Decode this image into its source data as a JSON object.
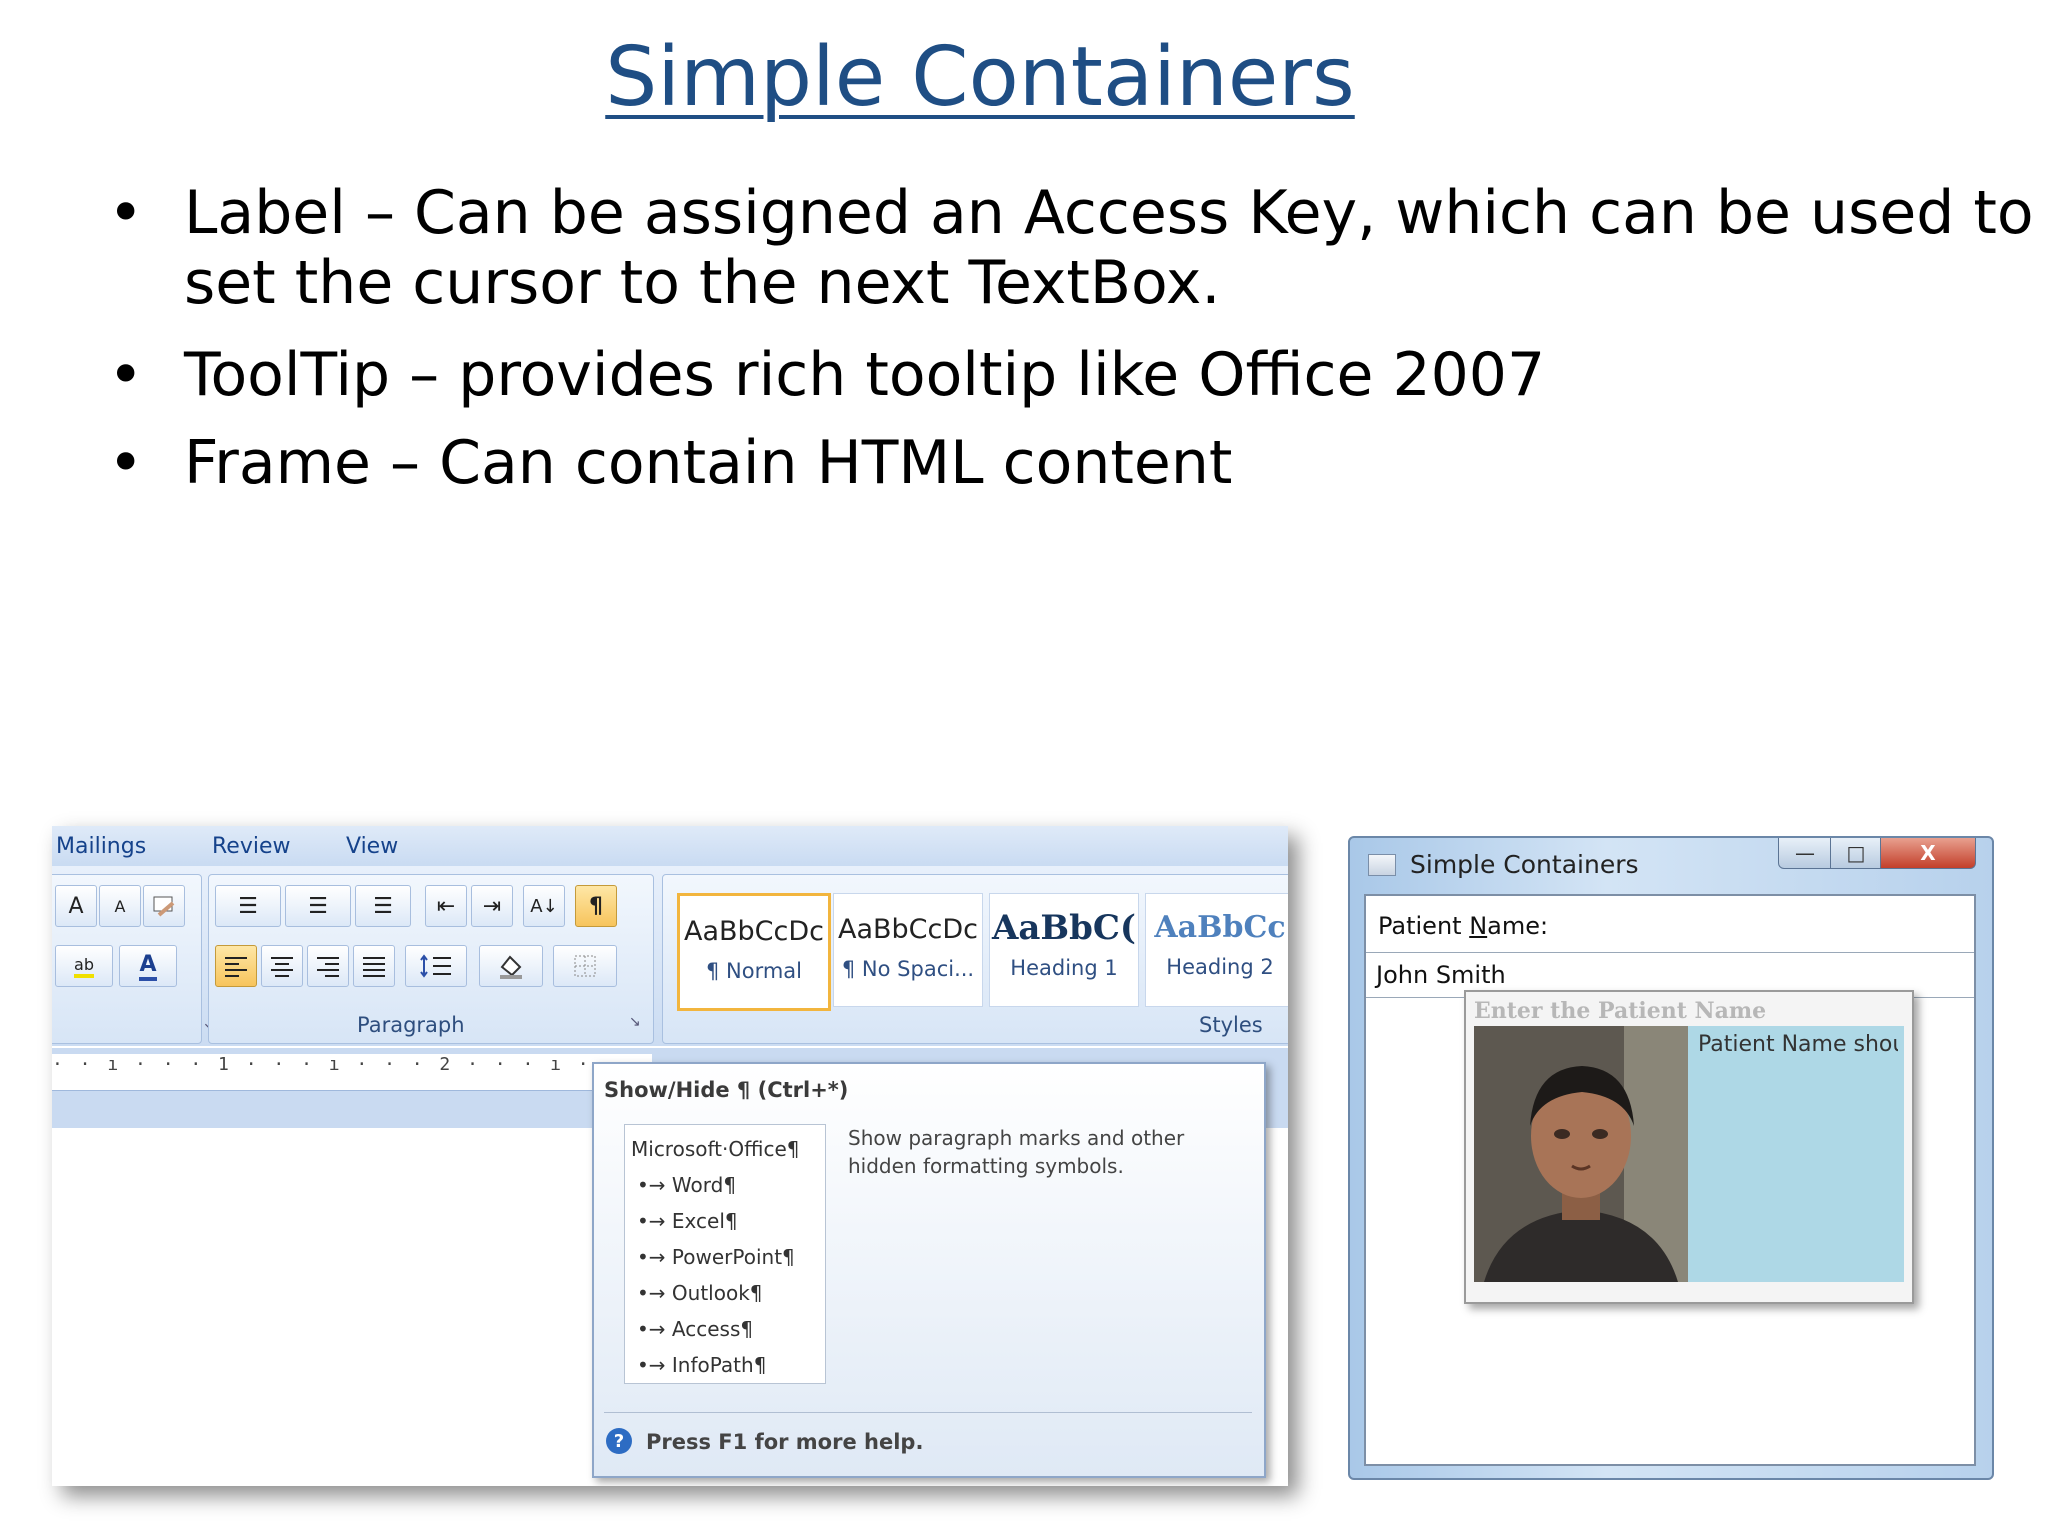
{
  "slide": {
    "title": "Simple Containers",
    "bullets": [
      {
        "symbol": "•",
        "text": "Label – Can be assigned an Access Key, which can be used to set the cursor to the next TextBox."
      },
      {
        "symbol": "•",
        "text": "ToolTip – provides rich tooltip like Office 2007"
      },
      {
        "symbol": "•",
        "text": "Frame – Can contain HTML content"
      }
    ]
  },
  "word": {
    "tabs": [
      "Mailings",
      "Review",
      "View"
    ],
    "groups": {
      "paragraph": "Paragraph",
      "styles": "Styles"
    },
    "font_buttons": {
      "grow": "A",
      "shrink": "A",
      "highlight": "ab",
      "font_color": "A"
    },
    "paragraph_buttons": {
      "bullets": "☰",
      "numbering": "☰",
      "multilevel": "☰",
      "decrease_indent": "⇤",
      "increase_indent": "⇥",
      "sort": "A↓",
      "show_hide": "¶"
    },
    "styles": [
      {
        "sample": "AaBbCcDc",
        "name": "¶ Normal",
        "selected": true
      },
      {
        "sample": "AaBbCcDc",
        "name": "¶ No Spaci...",
        "selected": false
      },
      {
        "sample": "AaBbC(",
        "name": "Heading 1",
        "selected": false
      },
      {
        "sample": "AaBbCc",
        "name": "Heading 2",
        "selected": false
      }
    ],
    "ruler": "· · ı · · · 1 · · · ı · · · 2 · · · ı · ·",
    "tooltip": {
      "title": "Show/Hide ¶ (Ctrl+*)",
      "image_lines": [
        "Microsoft·Office¶",
        "•→ Word¶",
        "•→ Excel¶",
        "•→ PowerPoint¶",
        "•→ Outlook¶",
        "•→ Access¶",
        "•→ InfoPath¶"
      ],
      "description": "Show paragraph marks and other hidden formatting symbols.",
      "help_icon": "?",
      "help": "Press F1 for more help."
    }
  },
  "window": {
    "title": "Simple Containers",
    "buttons": {
      "minimize": "—",
      "maximize": "□",
      "close": "X"
    },
    "label_prefix": "Patient ",
    "label_access_key": "N",
    "label_suffix": "ame:",
    "textbox_value": "John Smith",
    "tooltip_header": "Enter the Patient Name",
    "tooltip_text": "Patient Name shou"
  },
  "colors": {
    "title": "#1f4e84",
    "ribbon": "#cbdcf2",
    "selected_style": "#f2b53e",
    "tooltip_panel": "#aed8e6"
  }
}
